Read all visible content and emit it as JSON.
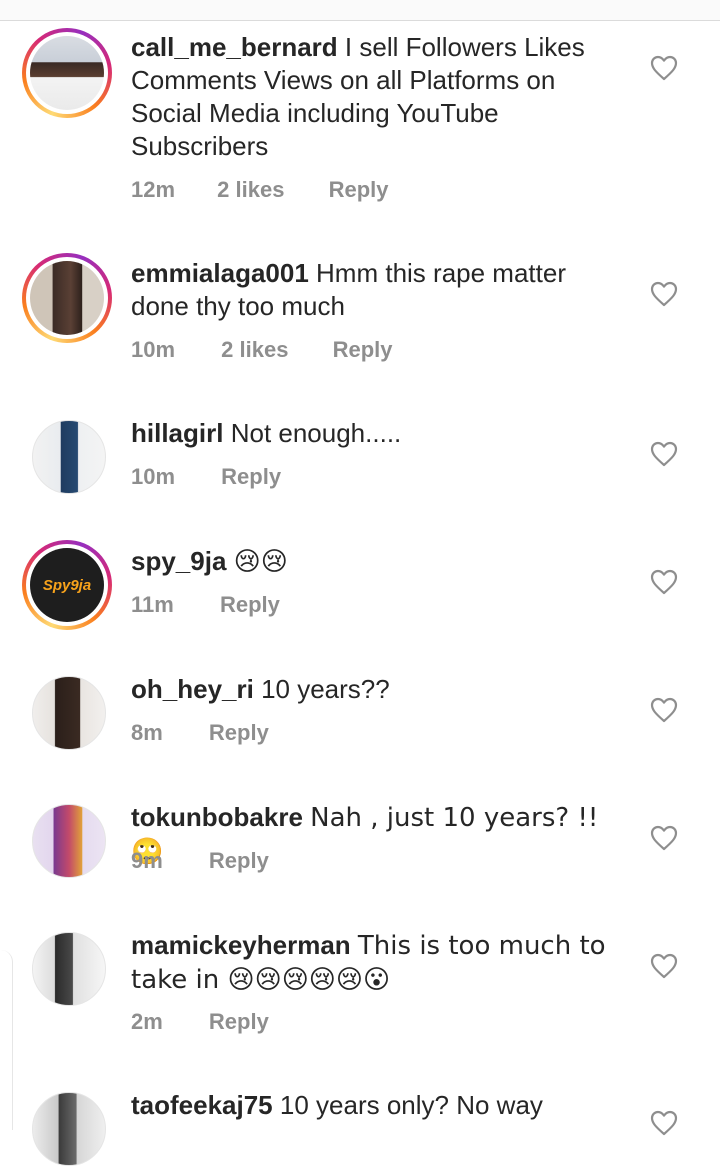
{
  "comments": [
    {
      "username": "call_me_bernard",
      "text": "I sell Followers Likes Comments Views on all Platforms on Social Media including YouTube Subscribers",
      "time": "12m",
      "likes": "2 likes",
      "reply": "Reply",
      "has_story": true
    },
    {
      "username": "emmialaga001",
      "text": "Hmm this rape matter done thy too much",
      "time": "10m",
      "likes": "2 likes",
      "reply": "Reply",
      "has_story": true
    },
    {
      "username": "hillagirl",
      "text": "Not enough.....",
      "time": "10m",
      "likes": "",
      "reply": "Reply",
      "has_story": false
    },
    {
      "username": "spy_9ja",
      "text": "😢😢",
      "time": "11m",
      "likes": "",
      "reply": "Reply",
      "has_story": true,
      "avatar_logo": "Spy9ja"
    },
    {
      "username": "oh_hey_ri",
      "text": "10 years??",
      "time": "8m",
      "likes": "",
      "reply": "Reply",
      "has_story": false
    },
    {
      "username": "tokunbobakre",
      "text": "Nah , just 10 years? !! 🙄",
      "time": "9m",
      "likes": "",
      "reply": "Reply",
      "has_story": false
    },
    {
      "username": "mamickeyherman",
      "text": "This is too much to take in 😢😢😢😢😢😮",
      "time": "2m",
      "likes": "",
      "reply": "Reply",
      "has_story": false
    },
    {
      "username": "taofeekaj75",
      "text": "10 years only? No way",
      "time": "",
      "likes": "",
      "reply": "",
      "has_story": false
    }
  ],
  "icons": {
    "like": "heart-outline-icon"
  },
  "colors": {
    "text": "#262626",
    "meta": "#8e8e8e",
    "story_ring": [
      "#feda75",
      "#fa7e1e",
      "#d62976",
      "#962fbf"
    ]
  }
}
